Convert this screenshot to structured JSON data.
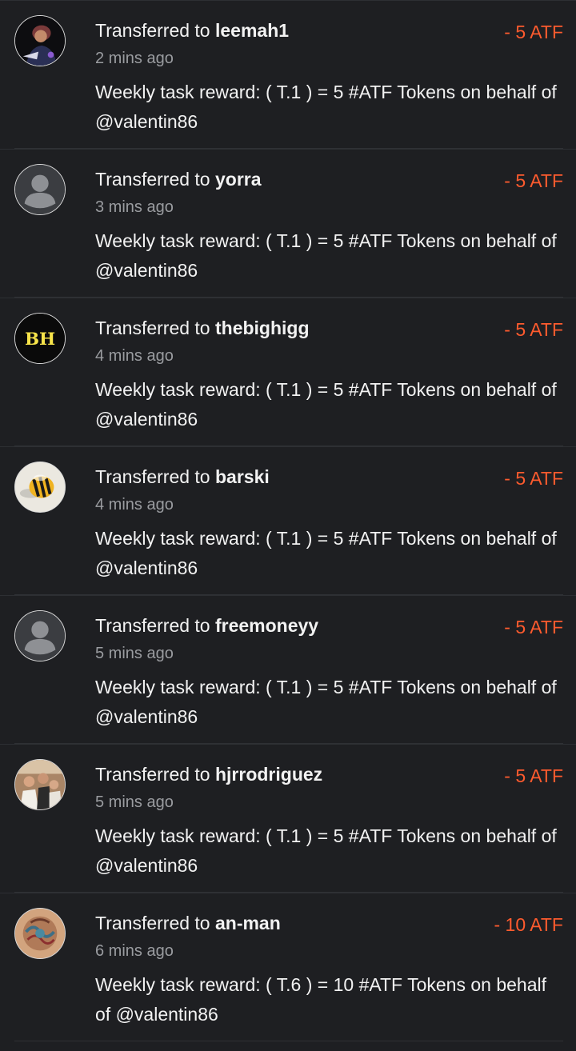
{
  "colors": {
    "background": "#1e1f22",
    "amount_negative": "#ff5b2e",
    "muted_text": "#9a9ca0",
    "bh_avatar_text": "#f7e44a"
  },
  "transactions": [
    {
      "prefix": "Transferred to",
      "user": "leemah1",
      "time": "2 mins ago",
      "amount": "- 5 ATF",
      "memo": "Weekly task reward: ( T.1 ) = 5 #ATF Tokens on behalf of @valentin86",
      "avatar": "photo-avatar"
    },
    {
      "prefix": "Transferred to",
      "user": "yorra",
      "time": "3 mins ago",
      "amount": "- 5 ATF",
      "memo": "Weekly task reward: ( T.1 ) = 5 #ATF Tokens on behalf of @valentin86",
      "avatar": "default-user-icon"
    },
    {
      "prefix": "Transferred to",
      "user": "thebighigg",
      "time": "4 mins ago",
      "amount": "- 5 ATF",
      "memo": "Weekly task reward: ( T.1 ) = 5 #ATF Tokens on behalf of @valentin86",
      "avatar": "bh-logo",
      "avatar_text": "BH"
    },
    {
      "prefix": "Transferred to",
      "user": "barski",
      "time": "4 mins ago",
      "amount": "- 5 ATF",
      "memo": "Weekly task reward: ( T.1 ) = 5 #ATF Tokens on behalf of @valentin86",
      "avatar": "bee-avatar"
    },
    {
      "prefix": "Transferred to",
      "user": "freemoneyy",
      "time": "5 mins ago",
      "amount": "- 5 ATF",
      "memo": "Weekly task reward: ( T.1 ) = 5 #ATF Tokens on behalf of @valentin86",
      "avatar": "default-user-icon"
    },
    {
      "prefix": "Transferred to",
      "user": "hjrrodriguez",
      "time": "5 mins ago",
      "amount": "- 5 ATF",
      "memo": "Weekly task reward: ( T.1 ) = 5 #ATF Tokens on behalf of @valentin86",
      "avatar": "group-photo-avatar"
    },
    {
      "prefix": "Transferred to",
      "user": "an-man",
      "time": "6 mins ago",
      "amount": "- 10 ATF",
      "memo": "Weekly task reward: ( T.6 ) = 10 #ATF Tokens on behalf of @valentin86",
      "avatar": "art-avatar"
    }
  ]
}
